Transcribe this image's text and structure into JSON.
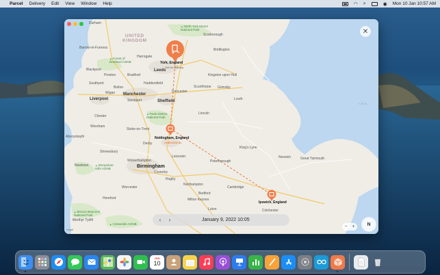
{
  "menubar": {
    "app_name": "Parcel",
    "menus": [
      "Delivery",
      "Edit",
      "View",
      "Window",
      "Help"
    ],
    "clock": "Mon 10 Jan  10:57 AM"
  },
  "map": {
    "country": "UNITED\nKINGDOM",
    "labels": [
      {
        "id": "durham",
        "text": "Durham",
        "type": "town"
      },
      {
        "id": "north-york-moors",
        "text": "North York Moors\nNational Park",
        "type": "park"
      },
      {
        "id": "scarborough",
        "text": "Scarborough",
        "type": "town"
      },
      {
        "id": "barrow",
        "text": "Barrow-in-Furness",
        "type": "town"
      },
      {
        "id": "bridlington",
        "text": "Bridlington",
        "type": "town"
      },
      {
        "id": "harrogate",
        "text": "Harrogate",
        "type": "town"
      },
      {
        "id": "forest-bowland",
        "text": "Forest of\nBowland AONB",
        "type": "park"
      },
      {
        "id": "blackpool",
        "text": "Blackpool",
        "type": "town"
      },
      {
        "id": "leeds",
        "text": "Leeds",
        "type": "city"
      },
      {
        "id": "kingston",
        "text": "Kingston upon Hull",
        "type": "town"
      },
      {
        "id": "bradford",
        "text": "Bradford",
        "type": "town"
      },
      {
        "id": "preston",
        "text": "Preston",
        "type": "town"
      },
      {
        "id": "southport",
        "text": "Southport",
        "type": "town"
      },
      {
        "id": "huddersfield",
        "text": "Huddersfield",
        "type": "town"
      },
      {
        "id": "grimsby",
        "text": "Grimsby",
        "type": "town"
      },
      {
        "id": "bolton",
        "text": "Bolton",
        "type": "town"
      },
      {
        "id": "scunthorpe",
        "text": "Scunthorpe",
        "type": "town"
      },
      {
        "id": "wigan",
        "text": "Wigan",
        "type": "town"
      },
      {
        "id": "manchester",
        "text": "Manchester",
        "type": "city"
      },
      {
        "id": "doncaster",
        "text": "Doncaster",
        "type": "town"
      },
      {
        "id": "louth",
        "text": "Louth",
        "type": "town"
      },
      {
        "id": "liverpool",
        "text": "Liverpool",
        "type": "city"
      },
      {
        "id": "stockport",
        "text": "Stockport",
        "type": "town"
      },
      {
        "id": "sheffield",
        "text": "Sheffield",
        "type": "city"
      },
      {
        "id": "peak-district",
        "text": "Peak District\nNational Park",
        "type": "park"
      },
      {
        "id": "lincoln",
        "text": "Lincoln",
        "type": "town"
      },
      {
        "id": "chester",
        "text": "Chester",
        "type": "town"
      },
      {
        "id": "wrexham",
        "text": "Wrexham",
        "type": "town"
      },
      {
        "id": "stoke",
        "text": "Stoke-on-Trent",
        "type": "town"
      },
      {
        "id": "derby",
        "text": "Derby",
        "type": "town"
      },
      {
        "id": "kings-lynn",
        "text": "King's Lynn",
        "type": "town"
      },
      {
        "id": "shrewsbury",
        "text": "Shrewsbury",
        "type": "town"
      },
      {
        "id": "norwich",
        "text": "Norwich",
        "type": "town"
      },
      {
        "id": "wolverhampton",
        "text": "Wolverhampton",
        "type": "town"
      },
      {
        "id": "leicester",
        "text": "Leicester",
        "type": "town"
      },
      {
        "id": "peterborough",
        "text": "Peterborough",
        "type": "town"
      },
      {
        "id": "great-yarmouth",
        "text": "Great Yarmouth",
        "type": "town"
      },
      {
        "id": "newtown",
        "text": "Newtown",
        "type": "town"
      },
      {
        "id": "shropshire",
        "text": "Shropshire\nHills AONB",
        "type": "park"
      },
      {
        "id": "birmingham",
        "text": "Birmingham",
        "type": "bigcity"
      },
      {
        "id": "coventry",
        "text": "Coventry",
        "type": "town"
      },
      {
        "id": "worcester",
        "text": "Worcester",
        "type": "town"
      },
      {
        "id": "rugby",
        "text": "Rugby",
        "type": "town"
      },
      {
        "id": "northampton",
        "text": "Northampton",
        "type": "town"
      },
      {
        "id": "cambridge",
        "text": "Cambridge",
        "type": "town"
      },
      {
        "id": "hereford",
        "text": "Hereford",
        "type": "town"
      },
      {
        "id": "bedford",
        "text": "Bedford",
        "type": "town"
      },
      {
        "id": "milton-keynes",
        "text": "Milton Keynes",
        "type": "town"
      },
      {
        "id": "brecon",
        "text": "Brecon Beacons\nNational Park",
        "type": "park"
      },
      {
        "id": "merthyr",
        "text": "Merthyr Tydfil",
        "type": "town"
      },
      {
        "id": "cotswolds",
        "text": "Cotswolds AONB",
        "type": "park"
      },
      {
        "id": "luton",
        "text": "Luton",
        "type": "town"
      },
      {
        "id": "colchester",
        "text": "Colchester",
        "type": "town"
      },
      {
        "id": "aberystwyth",
        "text": "Aberystwyth",
        "type": "town"
      }
    ],
    "sea_label": "≈ 20 m",
    "legal": "Legal"
  },
  "stops": {
    "york": {
      "name": "York, England",
      "status": "Out for delivery"
    },
    "nottingham": {
      "name": "Nottingham, England",
      "status": "CHECKED IN"
    },
    "ipswich": {
      "name": "Ipswich, England"
    }
  },
  "timeline": {
    "date": "January 9, 2022 10:05",
    "prev_glyph": "‹",
    "next_glyph": "›"
  },
  "controls": {
    "close_glyph": "✕",
    "zoom_out": "−",
    "zoom_in": "+",
    "compass": "N"
  },
  "dock": {
    "apps": [
      {
        "id": "finder",
        "icon": "finder-icon",
        "color": "#3d8ef0"
      },
      {
        "id": "launchpad",
        "icon": "launchpad-icon",
        "color": "#8a8e96"
      },
      {
        "id": "safari",
        "icon": "safari-icon",
        "color": "#1f8df0"
      },
      {
        "id": "messages",
        "icon": "messages-icon",
        "color": "#34c759"
      },
      {
        "id": "mail",
        "icon": "mail-icon",
        "color": "#2b86ef"
      },
      {
        "id": "maps",
        "icon": "maps-icon",
        "color": "#57b85c"
      },
      {
        "id": "photos",
        "icon": "photos-icon",
        "color": "#f4f4f4"
      },
      {
        "id": "facetime",
        "icon": "facetime-icon",
        "color": "#2fbf4f"
      },
      {
        "id": "calendar",
        "icon": "calendar-icon",
        "color": "#ffffff",
        "month": "JAN",
        "day": "10"
      },
      {
        "id": "contacts",
        "icon": "contacts-icon",
        "color": "#c9a27a"
      },
      {
        "id": "notes",
        "icon": "notes-icon",
        "color": "#f6d34b"
      },
      {
        "id": "music",
        "icon": "music-icon",
        "color": "#fb3d56"
      },
      {
        "id": "podcasts",
        "icon": "podcasts-icon",
        "color": "#9b4fd6"
      },
      {
        "id": "keynote",
        "icon": "keynote-icon",
        "color": "#2e7bf0"
      },
      {
        "id": "numbers",
        "icon": "numbers-icon",
        "color": "#38b449"
      },
      {
        "id": "pages",
        "icon": "pages-icon",
        "color": "#f7a33a"
      },
      {
        "id": "app-store",
        "icon": "app-store-icon",
        "color": "#1b8ef5"
      },
      {
        "id": "system-preferences",
        "icon": "system-preferences-icon",
        "color": "#7b7f86"
      },
      {
        "id": "screen-time",
        "icon": "infinity-icon",
        "color": "#1c9bd8"
      },
      {
        "id": "parcel",
        "icon": "parcel-box-icon",
        "color": "#f07a4a"
      }
    ],
    "trailing": [
      {
        "id": "document",
        "icon": "document-icon",
        "color": "#e9ecef"
      },
      {
        "id": "trash",
        "icon": "trash-icon",
        "color": "#d6dadf"
      }
    ]
  }
}
